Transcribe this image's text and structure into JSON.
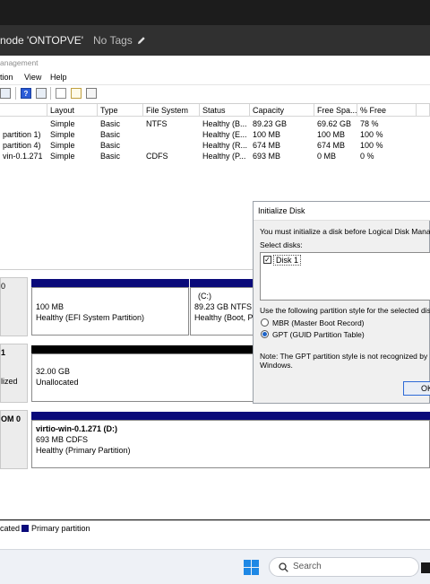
{
  "window": {
    "node_title": "node 'ONTOPVE'",
    "tags_label": "No Tags",
    "app_subtitle": "anagement"
  },
  "menu": [
    "tion",
    "View",
    "Help"
  ],
  "volume_table": {
    "columns": [
      "Layout",
      "Type",
      "File System",
      "Status",
      "Capacity",
      "Free Spa...",
      "% Free"
    ],
    "rows": [
      {
        "name": "",
        "layout": "Simple",
        "type": "Basic",
        "fs": "NTFS",
        "status": "Healthy (B...",
        "capacity": "89.23 GB",
        "free": "69.62 GB",
        "pct": "78 %"
      },
      {
        "name": "partition 1)",
        "layout": "Simple",
        "type": "Basic",
        "fs": "",
        "status": "Healthy (E...",
        "capacity": "100 MB",
        "free": "100 MB",
        "pct": "100 %"
      },
      {
        "name": "partition 4)",
        "layout": "Simple",
        "type": "Basic",
        "fs": "",
        "status": "Healthy (R...",
        "capacity": "674 MB",
        "free": "674 MB",
        "pct": "100 %"
      },
      {
        "name": "vin-0.1.271",
        "layout": "Simple",
        "type": "Basic",
        "fs": "CDFS",
        "status": "Healthy (P...",
        "capacity": "693 MB",
        "free": "0 MB",
        "pct": "0 %"
      }
    ]
  },
  "disks": [
    {
      "label_lines": [
        "0"
      ],
      "partitions": [
        {
          "title": "",
          "line1": "100 MB",
          "line2": "Healthy (EFI System Partition)"
        },
        {
          "title": "(C:)",
          "line1": "89.23 GB NTFS",
          "line2": "Healthy (Boot, Pa"
        }
      ]
    },
    {
      "label_lines": [
        "1",
        "",
        "lized"
      ],
      "partitions": [
        {
          "title": "",
          "line1": "32.00 GB",
          "line2": "Unallocated"
        }
      ]
    },
    {
      "label_lines": [
        "OM 0"
      ],
      "partitions": [
        {
          "title": "virtio-win-0.1.271  (D:)",
          "line1": "693 MB CDFS",
          "line2": "Healthy (Primary Partition)"
        }
      ]
    }
  ],
  "legend": {
    "unallocated": "cated",
    "primary": "Primary partition"
  },
  "dialog": {
    "title": "Initialize Disk",
    "intro": "You must initialize a disk before Logical Disk Manager c",
    "select_label": "Select disks:",
    "disk_item": "Disk 1",
    "style_prompt": "Use the following partition style for the selected disks:",
    "mbr_label": "MBR (Master Boot Record)",
    "gpt_label": "GPT (GUID Partition Table)",
    "note_line1": "Note: The GPT partition style is not recognized by all pr",
    "note_line2": "Windows.",
    "ok_label": "OK",
    "selected_style": "GPT"
  },
  "taskbar": {
    "search_placeholder": "Search"
  },
  "colors": {
    "primary_stripe": "#0a0a7a",
    "unallocated_stripe": "#000000",
    "accent": "#1e64c8"
  }
}
